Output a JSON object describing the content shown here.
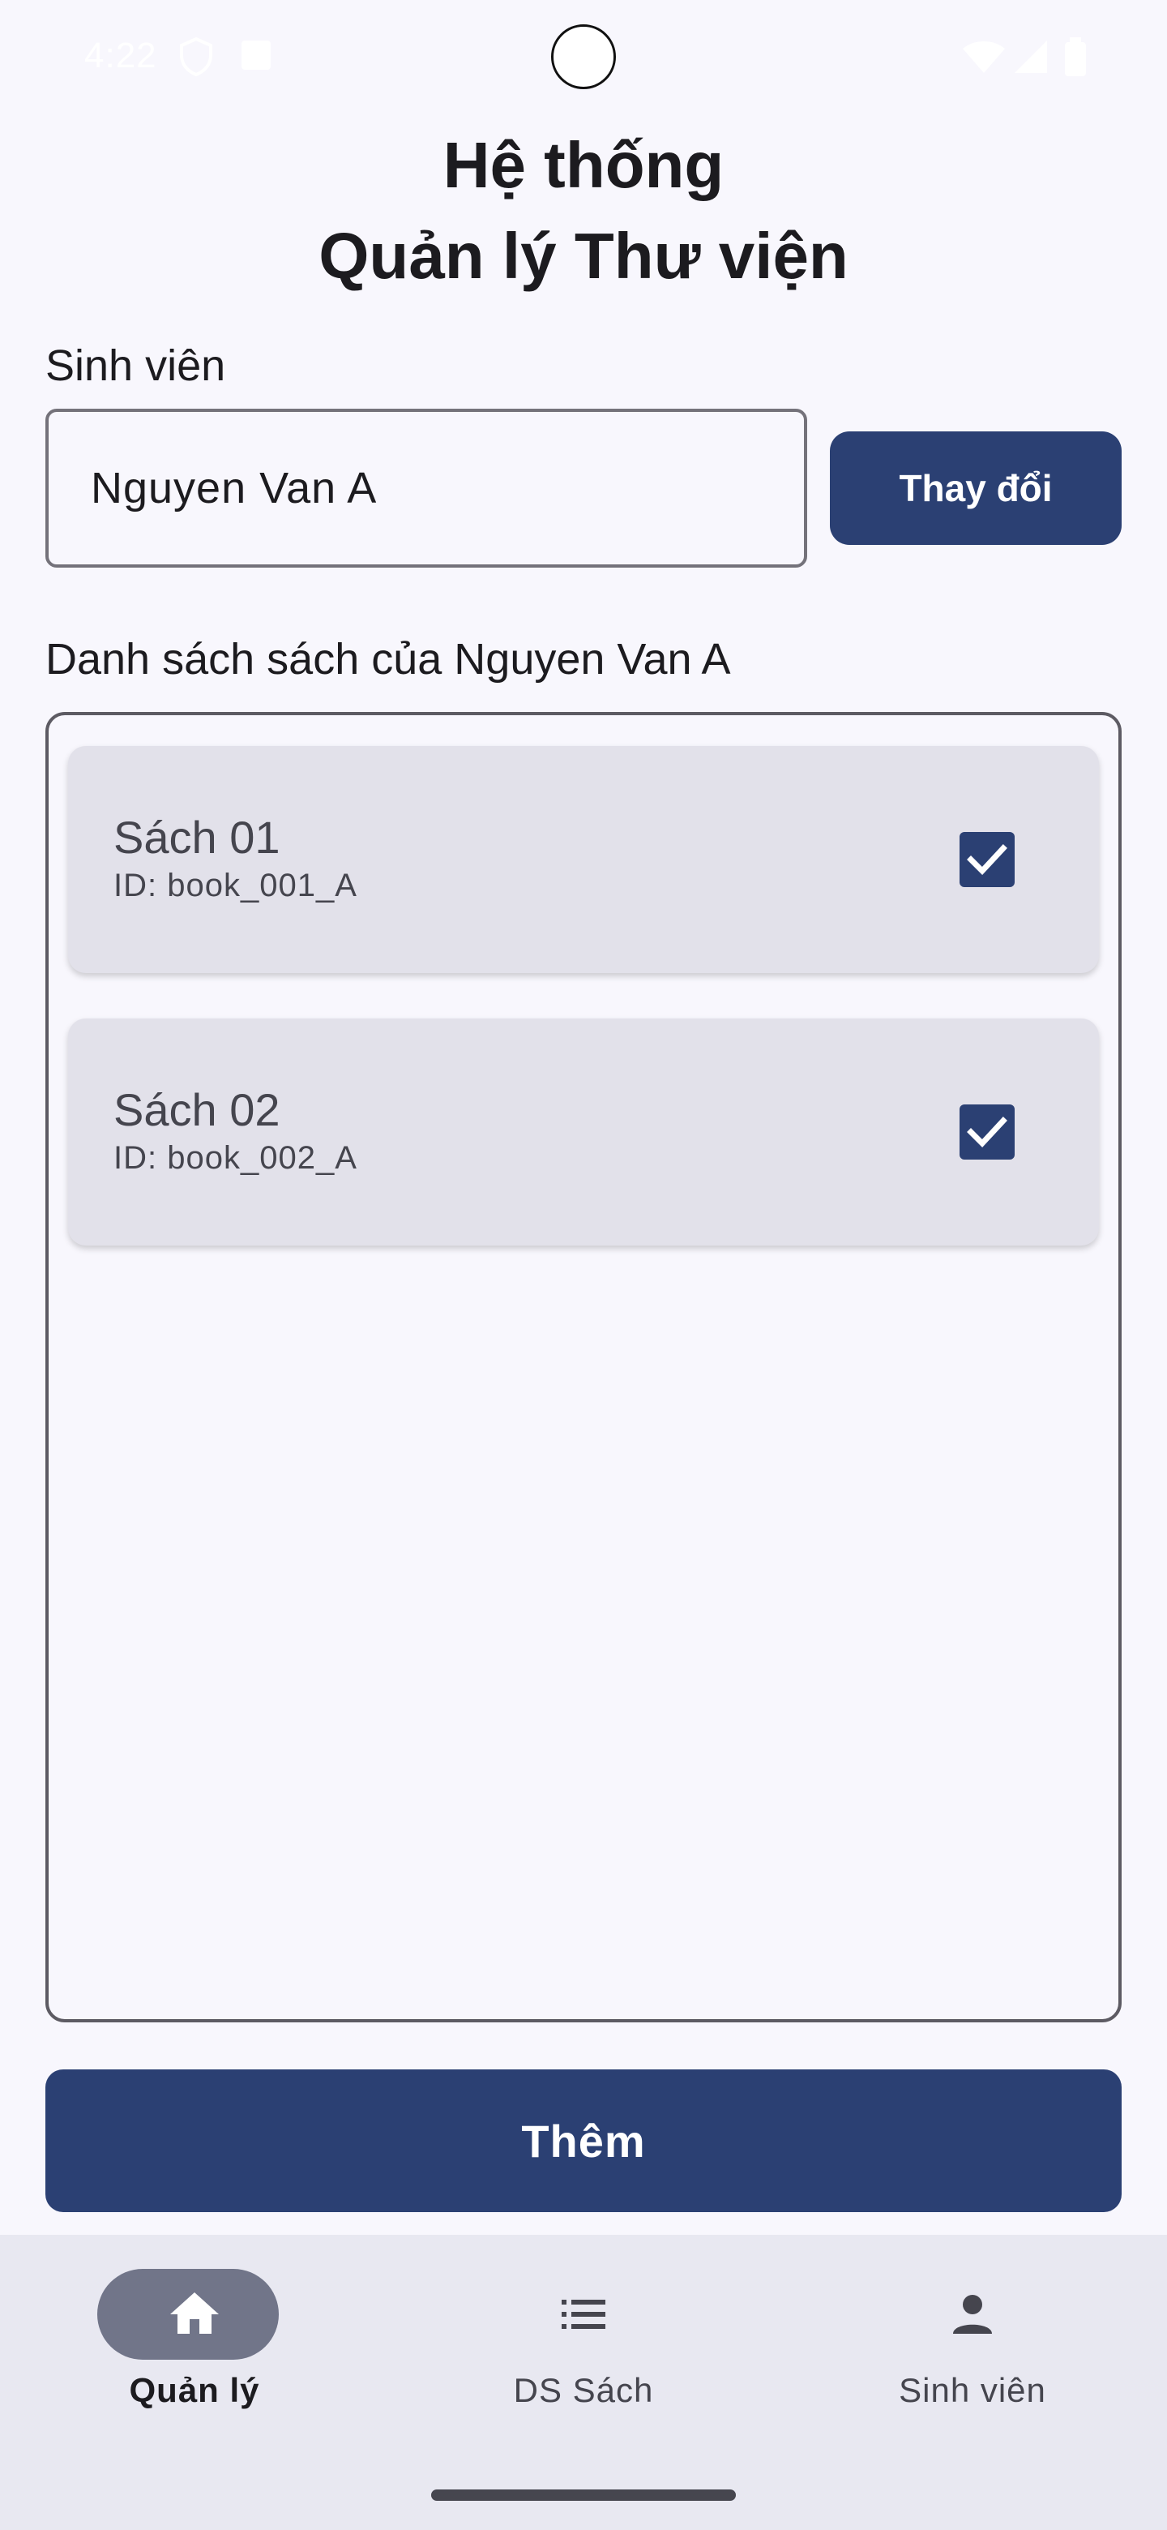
{
  "status_bar": {
    "time": "4:22"
  },
  "header": {
    "title_line1": "Hệ thống",
    "title_line2": "Quản lý Thư viện"
  },
  "student": {
    "label": "Sinh viên",
    "input_value": "Nguyen Van A",
    "change_button": "Thay đổi"
  },
  "book_list": {
    "heading": "Danh sách sách của Nguyen Van A",
    "items": [
      {
        "title": "Sách 01",
        "id": "ID: book_001_A",
        "checked": true
      },
      {
        "title": "Sách 02",
        "id": "ID: book_002_A",
        "checked": true
      }
    ]
  },
  "add_button": "Thêm",
  "bottom_nav": {
    "items": [
      {
        "label": "Quản lý",
        "icon": "home-icon",
        "selected": true
      },
      {
        "label": "DS Sách",
        "icon": "list-icon",
        "selected": false
      },
      {
        "label": "Sinh viên",
        "icon": "person-icon",
        "selected": false
      }
    ]
  },
  "colors": {
    "primary": "#2b4073",
    "card": "#e2e1ea",
    "background": "#f8f7fd",
    "nav_bg": "#e8e8f1"
  }
}
